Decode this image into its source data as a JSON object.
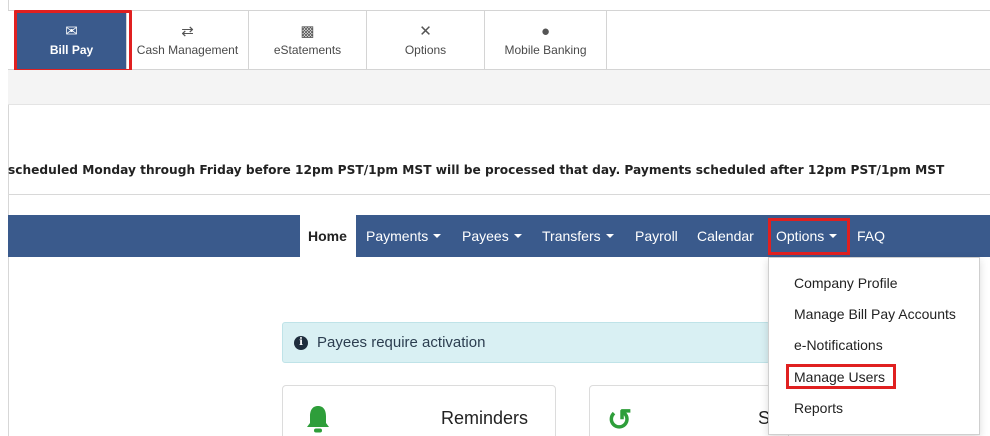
{
  "top_tabs": [
    {
      "label": "Bill Pay",
      "icon": "envelope-open-icon"
    },
    {
      "label": "Cash Management",
      "icon": "shuffle-icon"
    },
    {
      "label": "eStatements",
      "icon": "briefcase-icon"
    },
    {
      "label": "Options",
      "icon": "tools-icon"
    },
    {
      "label": "Mobile Banking",
      "icon": "pin-icon"
    }
  ],
  "banner": {
    "text": "scheduled Monday through Friday before 12pm PST/1pm MST will be processed that day. Payments scheduled after 12pm PST/1pm MST"
  },
  "nav": {
    "home": "Home",
    "payments": "Payments",
    "payees": "Payees",
    "transfers": "Transfers",
    "payroll": "Payroll",
    "calendar": "Calendar",
    "options": "Options",
    "faq": "FAQ"
  },
  "options_menu": [
    "Company Profile",
    "Manage Bill Pay Accounts",
    "e-Notifications",
    "Manage Users",
    "Reports"
  ],
  "alert": {
    "text": "Payees require activation"
  },
  "cards": {
    "reminders": "Reminders",
    "second_partial": "S"
  },
  "colors": {
    "nav_bg": "#3a5a8c",
    "highlight": "#e02020",
    "alert_bg": "#d9f0f3",
    "icon_green": "#2e9e3a"
  }
}
